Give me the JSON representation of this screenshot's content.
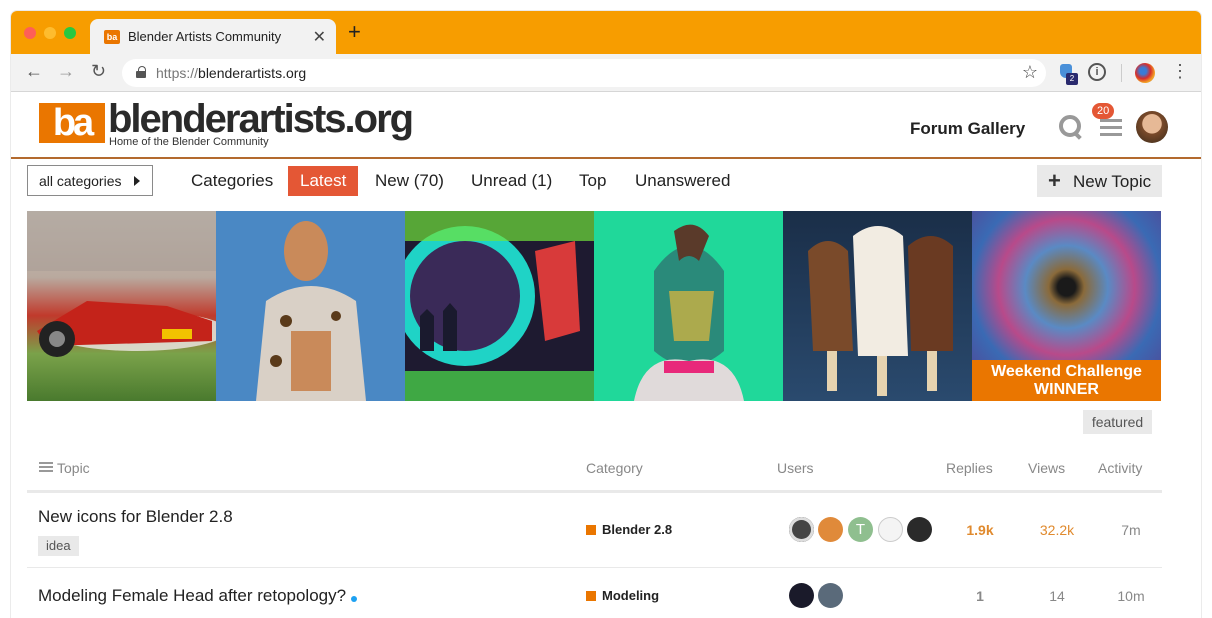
{
  "browser": {
    "tab_title": "Blender Artists Community",
    "tab_favicon_text": "ba",
    "url_scheme": "https://",
    "url_host": "blenderartists.org",
    "extension_badge": "2",
    "info_icon_glyph": "i"
  },
  "header": {
    "logo_mark": "ba",
    "logo_text": "blenderartists.org",
    "logo_sub": "Home of the Blender Community",
    "forum_gallery": "Forum Gallery",
    "notification_count": "20"
  },
  "nav": {
    "category_dropdown": "all categories",
    "items": [
      "Categories",
      "Latest",
      "New (70)",
      "Unread (1)",
      "Top",
      "Unanswered"
    ],
    "active": "Latest",
    "new_topic": "New Topic"
  },
  "banner": {
    "challenge_line1": "Weekend Challenge",
    "challenge_line2": "WINNER"
  },
  "featured_tag": "featured",
  "table": {
    "headers": {
      "topic": "Topic",
      "category": "Category",
      "users": "Users",
      "replies": "Replies",
      "views": "Views",
      "activity": "Activity"
    },
    "rows": [
      {
        "title": "New icons for Blender 2.8",
        "tag": "idea",
        "category": "Blender 2.8",
        "user_avatars": [
          "dark-ring-avatar",
          "orange-character-avatar",
          "T",
          "sketch-avatar",
          "dark-portrait-avatar"
        ],
        "replies": "1.9k",
        "views": "32.2k",
        "activity": "7m"
      },
      {
        "title": "Modeling Female Head after retopology?",
        "category": "Modeling",
        "user_avatars": [
          "dark-sphere-avatar",
          "sunglasses-avatar"
        ],
        "replies": "1",
        "views": "14",
        "activity": "10m"
      }
    ]
  },
  "colors": {
    "accent_orange": "#ea7600",
    "active_tab_red": "#e45735",
    "browser_chrome_orange": "#f79d00",
    "hot_number": "#e08a2e"
  }
}
